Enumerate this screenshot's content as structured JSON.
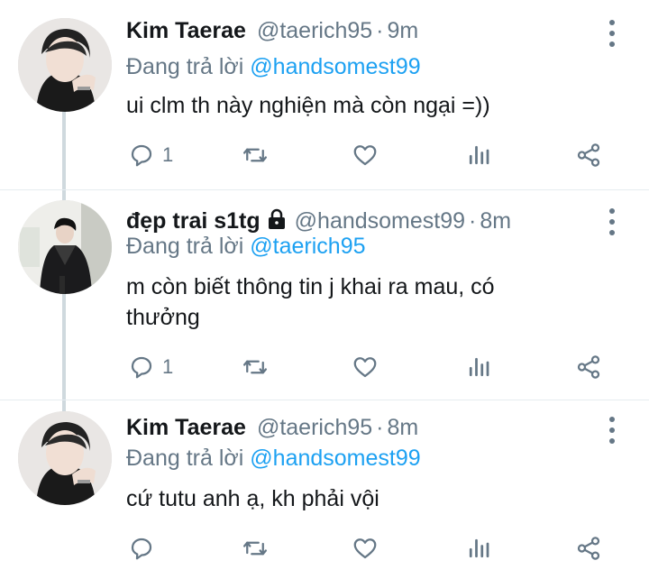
{
  "tweets": [
    {
      "name": "Kim Taerae",
      "handle": "@taerich95",
      "time": "9m",
      "reply_prefix": "Đang trả lời ",
      "reply_to": "@handsomest99",
      "text": "ui clm th này nghiện mà còn ngại =))",
      "reply_count": "1",
      "avatar": "avatar-kim-taerae"
    },
    {
      "name": "đẹp trai s1tg",
      "handle": "@handsomest99",
      "time": "8m",
      "protected": true,
      "reply_prefix": "Đang trả lời ",
      "reply_to": "@taerich95",
      "text": "m còn biết thông tin j khai ra mau, có thưởng",
      "reply_count": "1",
      "avatar": "avatar-handsomest99"
    },
    {
      "name": "Kim Taerae",
      "handle": "@taerich95",
      "time": "8m",
      "reply_prefix": "Đang trả lời ",
      "reply_to": "@handsomest99",
      "text": "cứ tutu anh ạ, kh phải vội",
      "reply_count": "",
      "avatar": "avatar-kim-taerae"
    }
  ],
  "separator": "·",
  "icons": {
    "reply": "speech-bubble-icon",
    "retweet": "retweet-icon",
    "like": "heart-icon",
    "analytics": "bar-chart-icon",
    "share": "share-icon",
    "more": "more-vertical-icon",
    "lock": "lock-icon"
  },
  "colors": {
    "link": "#1da1f2",
    "secondary_text": "#657786",
    "primary_text": "#14171a",
    "thread_line": "#cfd9de"
  }
}
